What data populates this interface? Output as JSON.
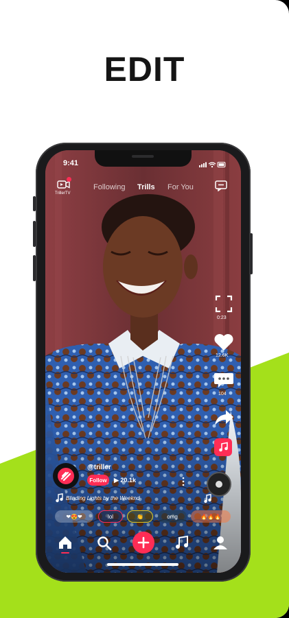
{
  "headline": "EDIT",
  "status_bar": {
    "time": "9:41"
  },
  "top_bar": {
    "channel_label": "TrillerTV",
    "tabs": [
      {
        "label": "Following",
        "active": false
      },
      {
        "label": "Trills",
        "active": true
      },
      {
        "label": "For You",
        "active": false
      }
    ]
  },
  "side_actions": {
    "fullscreen_count": "0:23",
    "like_count": "12.6K",
    "comment_count": "104"
  },
  "creator": {
    "handle": "@triller",
    "follow_label": "Follow",
    "views": "▶ 20.1k"
  },
  "song": "Blinding Lights by the Weeknd",
  "reaction_pills": [
    "❤😍❤",
    "lol",
    "👏",
    "omg",
    "🔥🔥🔥"
  ],
  "bottom_nav": [
    "home-icon",
    "search-icon",
    "add-icon",
    "music-icon",
    "profile-icon"
  ],
  "colors": {
    "accent": "#ff2d55",
    "lime": "#a4e01b",
    "headline": "#151515"
  }
}
